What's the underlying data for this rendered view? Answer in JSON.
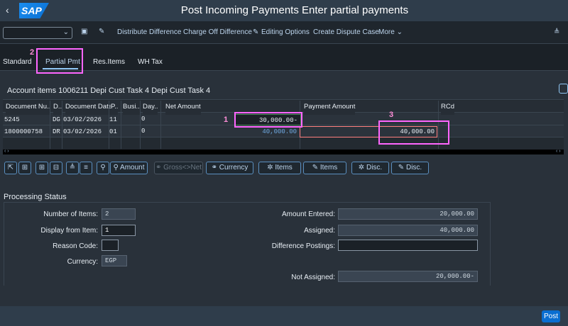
{
  "header": {
    "title": "Post Incoming Payments Enter partial payments",
    "logo": "SAP"
  },
  "toolbar": {
    "items": [
      "Distribute Difference",
      "Charge Off Difference",
      "Editing Options",
      "Create Dispute Case",
      "More"
    ]
  },
  "tabs": [
    "Standard",
    "Partial Pmt",
    "Res.Items",
    "WH Tax"
  ],
  "section_title": "Account items 1006211 Depi Cust Task 4 Depi Cust Task 4",
  "table": {
    "columns": [
      "Document Nu..",
      "D..",
      "Document Date",
      "P..",
      "Busi..",
      "Day..",
      "Net Amount",
      "Payment Amount",
      "RCd"
    ],
    "rows": [
      {
        "doc": "5245",
        "d": "DG",
        "date": "03/02/2026",
        "p": "11",
        "busi": "",
        "day": "0",
        "net": "30,000.00-",
        "pay": ""
      },
      {
        "doc": "1800000758",
        "d": "DR",
        "date": "03/02/2026",
        "p": "01",
        "busi": "",
        "day": "0",
        "net": "40,000.00",
        "pay": "40,000.00"
      }
    ]
  },
  "buttons": {
    "amount": "Amount",
    "gross_net": "Gross<>Net",
    "currency": "Currency",
    "items1": "Items",
    "items2": "Items",
    "disc1": "Disc.",
    "disc2": "Disc."
  },
  "annotations": [
    "1",
    "2",
    "3"
  ],
  "status": {
    "title": "Processing Status",
    "num_items_label": "Number of Items:",
    "num_items": "2",
    "display_from_label": "Display from Item:",
    "display_from": "1",
    "reason_label": "Reason Code:",
    "reason": "",
    "currency_label": "Currency:",
    "currency": "EGP",
    "amount_entered_label": "Amount Entered:",
    "amount_entered": "20,000.00",
    "assigned_label": "Assigned:",
    "assigned": "40,000.00",
    "diff_label": "Difference Postings:",
    "diff": "",
    "not_assigned_label": "Not Assigned:",
    "not_assigned": "20,000.00-"
  },
  "footer": {
    "post": "Post"
  }
}
